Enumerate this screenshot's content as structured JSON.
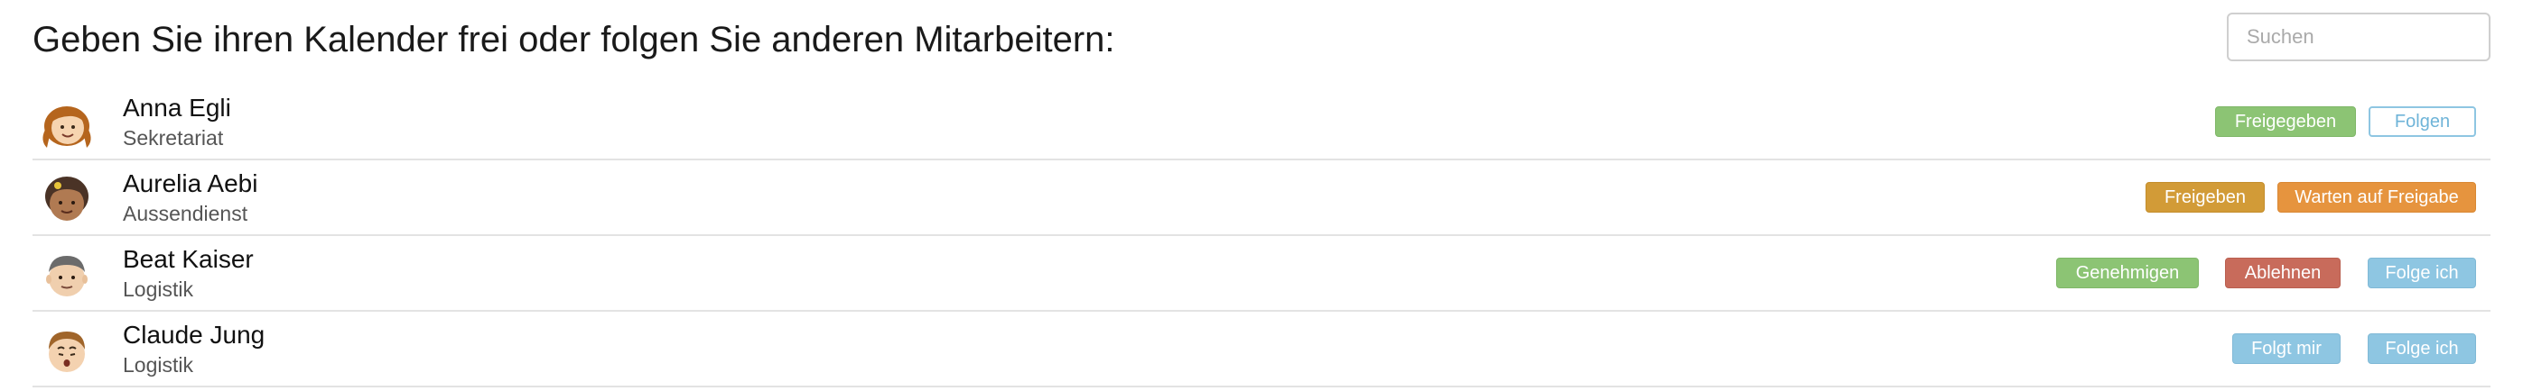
{
  "header": {
    "title": "Geben Sie ihren Kalender frei oder folgen Sie anderen Mitarbeitern:",
    "search_placeholder": "Suchen"
  },
  "people": [
    {
      "name": "Anna Egli",
      "department": "Sekretariat",
      "avatar_icon": "girl-avatar-icon",
      "actions": [
        {
          "label": "Freigegeben",
          "color": "#8cc474"
        },
        {
          "label": "Folgen",
          "color": "#8ec6e2",
          "style": "outline"
        }
      ]
    },
    {
      "name": "Aurelia Aebi",
      "department": "Aussendienst",
      "avatar_icon": "woman-avatar-icon",
      "actions": [
        {
          "label": "Freigeben",
          "color": "#d29b37"
        },
        {
          "label": "Warten auf Freigabe",
          "color": "#e6943e"
        }
      ]
    },
    {
      "name": "Beat Kaiser",
      "department": "Logistik",
      "avatar_icon": "man-avatar-icon",
      "actions": [
        {
          "label": "Genehmigen",
          "color": "#8cc474"
        },
        {
          "label": "Ablehnen",
          "color": "#c86b5b"
        },
        {
          "label": "Folge ich",
          "color": "#8ec6e2"
        }
      ]
    },
    {
      "name": "Claude Jung",
      "department": "Logistik",
      "avatar_icon": "boy-avatar-icon",
      "actions": [
        {
          "label": "Folgt mir",
          "color": "#8ec6e2"
        },
        {
          "label": "Folge ich",
          "color": "#8ec6e2"
        }
      ]
    }
  ]
}
